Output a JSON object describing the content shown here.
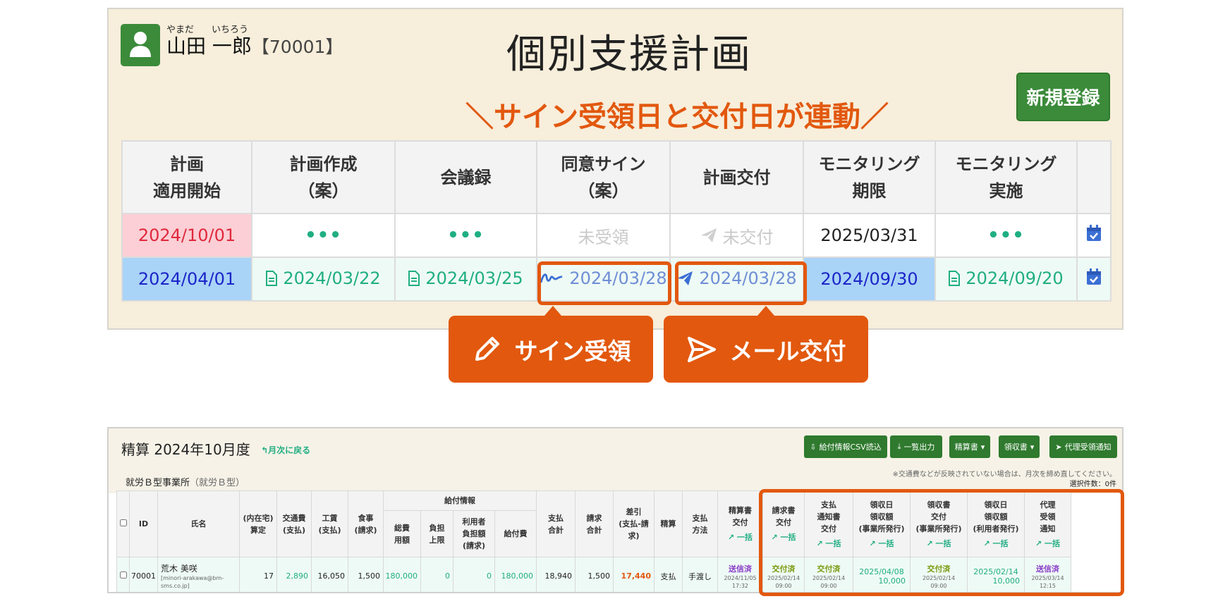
{
  "user": {
    "ruby_family": "やまだ",
    "ruby_given": "いちろう",
    "name": "山田 一郎",
    "id": "【70001】"
  },
  "page_title": "個別支援計画",
  "new_button": "新規登録",
  "callout": "＼サイン受領日と交付日が連動／",
  "plan_table": {
    "headers": [
      [
        "計画",
        "適用開始"
      ],
      [
        "計画作成",
        "（案）"
      ],
      [
        "会議録",
        ""
      ],
      [
        "同意サイン",
        "（案）"
      ],
      [
        "計画交付",
        ""
      ],
      [
        "モニタリング",
        "期限"
      ],
      [
        "モニタリング",
        "実施"
      ]
    ],
    "row1": {
      "start": "2024/10/01",
      "draft": "•••",
      "minutes": "•••",
      "sign": "未受領",
      "delivery": "未交付",
      "monitor_deadline": "2025/03/31",
      "monitor_done": "•••"
    },
    "row2": {
      "start": "2024/04/01",
      "draft": "2024/03/22",
      "minutes": "2024/03/25",
      "sign": "2024/03/28",
      "delivery": "2024/03/28",
      "monitor_deadline": "2024/09/30",
      "monitor_done": "2024/09/20"
    }
  },
  "buttons": {
    "sign_receive": "サイン受領",
    "mail_delivery": "メール交付"
  },
  "settlement": {
    "title": "精算 2024年10月度",
    "back": "月次に戻る",
    "toolbar": {
      "csv": "給付情報CSV読込",
      "export": "一覧出力",
      "statement": "精算書",
      "receipt": "領収書",
      "proxy": "代理受領通知"
    },
    "office": "就労Ｂ型事業所",
    "office_type": "（就労Ｂ型）",
    "note": "※交通費などが反映されていない場合は、月次を締め直してください。",
    "selected": "選択件数：0件",
    "headers": {
      "id": "ID",
      "name": "氏名",
      "home": [
        "(内在宅)",
        "算定"
      ],
      "transport": [
        "交通費",
        "(支払)"
      ],
      "wage": [
        "工賃",
        "(支払)"
      ],
      "meal": [
        "食事",
        "(請求)"
      ],
      "benefit_group": "給付情報",
      "total_cost": [
        "総費",
        "用額"
      ],
      "burden_cap": [
        "負担",
        "上限"
      ],
      "user_burden": [
        "利用者",
        "負担額",
        "(請求)"
      ],
      "benefit": "給付費",
      "pay_total": [
        "支払",
        "合計"
      ],
      "bill_total": [
        "請求",
        "合計"
      ],
      "diff": [
        "差引",
        "(支払-請",
        "求)"
      ],
      "settle": "精算",
      "pay_method": [
        "支払",
        "方法"
      ],
      "statement_delivery": [
        "精算書",
        "交付"
      ],
      "invoice_delivery": [
        "請求書",
        "交付"
      ],
      "payment_notice": [
        "支払",
        "通知書",
        "交付"
      ],
      "receipt_amount_office": [
        "領収日",
        "領収額",
        "(事業所発行)"
      ],
      "receipt_delivery_office": [
        "領収書",
        "交付",
        "(事業所発行)"
      ],
      "receipt_amount_user": [
        "領収日",
        "領収額",
        "(利用者発行)"
      ],
      "proxy_notice": [
        "代理",
        "受領",
        "通知"
      ],
      "bulk": "一括"
    },
    "row": {
      "id": "70001",
      "name": "荒木 美咲",
      "email": "[minori-arakawa@bm-sms.co.jp]",
      "home": "17",
      "transport": "2,890",
      "wage": "16,050",
      "meal": "1,500",
      "total_cost": "180,000",
      "burden_cap": "0",
      "user_burden": "0",
      "benefit": "180,000",
      "pay_total": "18,940",
      "bill_total": "1,500",
      "diff": "17,440",
      "settle": "支払",
      "pay_method": "手渡し",
      "statement_status": "送信済",
      "statement_date": "2024/11/05",
      "statement_time": "17:32",
      "invoice_status": "交付済",
      "invoice_date": "2025/02/14",
      "invoice_time": "09:00",
      "payment_status": "交付済",
      "payment_date": "2025/02/14",
      "payment_time": "09:00",
      "receipt_office_date": "2025/04/08",
      "receipt_office_amount": "10,000",
      "receipt_delivery_status": "交付済",
      "receipt_delivery_date": "2025/02/14",
      "receipt_delivery_time": "09:00",
      "receipt_user_date": "2025/02/14",
      "receipt_user_amount": "10,000",
      "proxy_status": "送信済",
      "proxy_date": "2025/03/14",
      "proxy_time": "12:15"
    }
  }
}
